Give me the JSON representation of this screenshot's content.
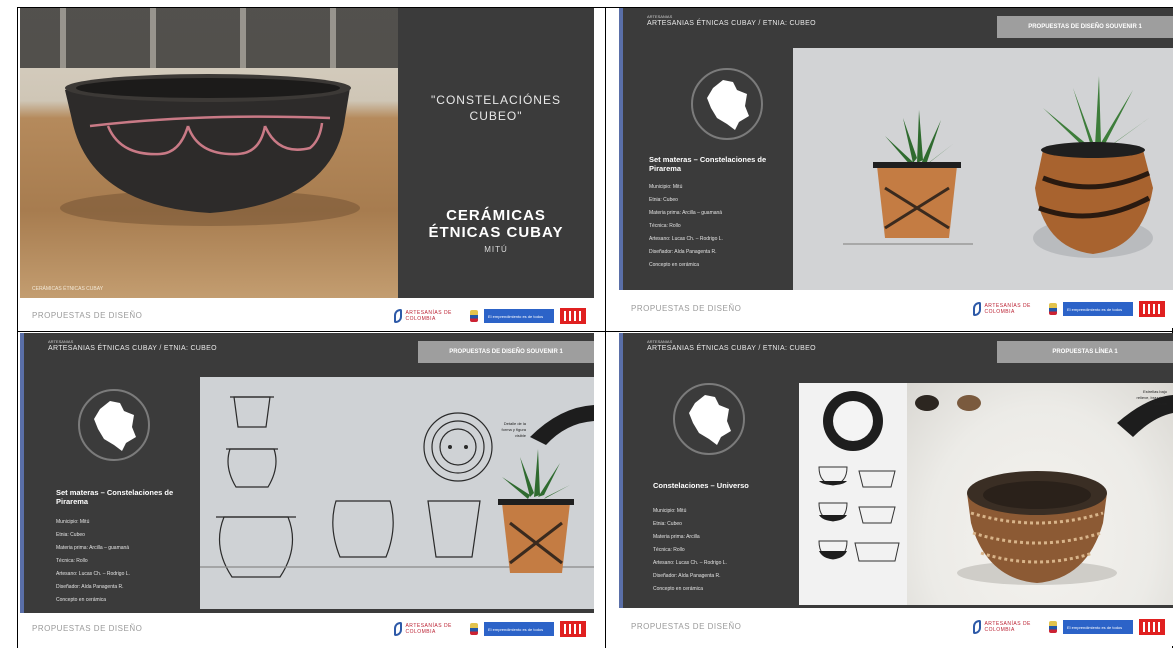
{
  "slide1": {
    "title_quote": "\"CONSTELACIÓNES\nCUBEO\"",
    "main_title": "CERÁMICAS\nÉTNICAS CUBAY",
    "subtitle": "MITÚ",
    "photo_caption": "CERÁMICAS ÉTNICAS CUBAY",
    "footer_label": "PROPUESTAS DE DISEÑO"
  },
  "slide2": {
    "tiny_label": "ARTESANIAS",
    "header": "ARTESANIAS ÉTNICAS CUBAY / ETNIA: CUBEO",
    "badge": "PROPUESTAS DE DISEÑO SOUVENIR 1",
    "set_name": "Set materas – Constelaciones de Pirarema",
    "details": [
      "Municipio: Mitú",
      "Etnia: Cubeo",
      "Materia prima: Arcilla – guamaná",
      "Técnica: Rollo",
      "Artesano: Lucas Ch. – Rodrigo L.",
      "Diseñador: Aída Panagenta R.",
      "Concepto en cerámica"
    ],
    "footer_label": "PROPUESTAS DE DISEÑO"
  },
  "slide3": {
    "tiny_label": "ARTESANIAS",
    "header": "ARTESANIAS ÉTNICAS CUBAY / ETNIA: CUBEO",
    "badge": "PROPUESTAS DE DISEÑO SOUVENIR 1",
    "set_name": "Set materas – Constelaciones de Pirarema",
    "details": [
      "Municipio: Mitú",
      "Etnia: Cubeo",
      "Materia prima: Arcilla – guamaná",
      "Técnica: Rollo",
      "Artesano: Lucas Ch. – Rodrigo L.",
      "Diseñador: Aída Panagenta R.",
      "Concepto en cerámica"
    ],
    "note": "Detalle de la\nforma y figura\nvisible",
    "footer_label": "PROPUESTAS DE DISEÑO"
  },
  "slide4": {
    "tiny_label": "ARTESANIAS",
    "header": "ARTESANIAS ÉTNICAS CUBAY / ETNIA: CUBEO",
    "badge": "PROPUESTAS LÍNEA 1",
    "set_name": "Constelaciones – Universo",
    "details": [
      "Municipio: Mitú",
      "Etnia: Cubeo",
      "Materia prima: Arcilla",
      "Técnica: Rollo",
      "Artesano: Lucas Ch. – Rodrigo L.",
      "Diseñador: Aída Panagenta R.",
      "Concepto en cerámica"
    ],
    "note": "Estrellas bajo\nrelieve, brazalete\nincisión",
    "footer_label": "PROPUESTAS DE DISEÑO"
  },
  "logos": {
    "ac_text": "ARTESANÍAS DE COLOMBIA",
    "blue_text": "El emprendimiento es de todos"
  }
}
